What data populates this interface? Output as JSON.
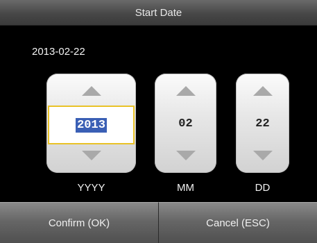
{
  "dialog": {
    "title": "Start Date"
  },
  "current_date": "2013-02-22",
  "fields": {
    "year": {
      "value": "2013",
      "label": "YYYY"
    },
    "month": {
      "value": "02",
      "label": "MM"
    },
    "day": {
      "value": "22",
      "label": "DD"
    }
  },
  "buttons": {
    "confirm": "Confirm (OK)",
    "cancel": "Cancel (ESC)"
  },
  "colors": {
    "selection_border": "#e9c227",
    "selection_highlight": "#3a5fb5"
  }
}
